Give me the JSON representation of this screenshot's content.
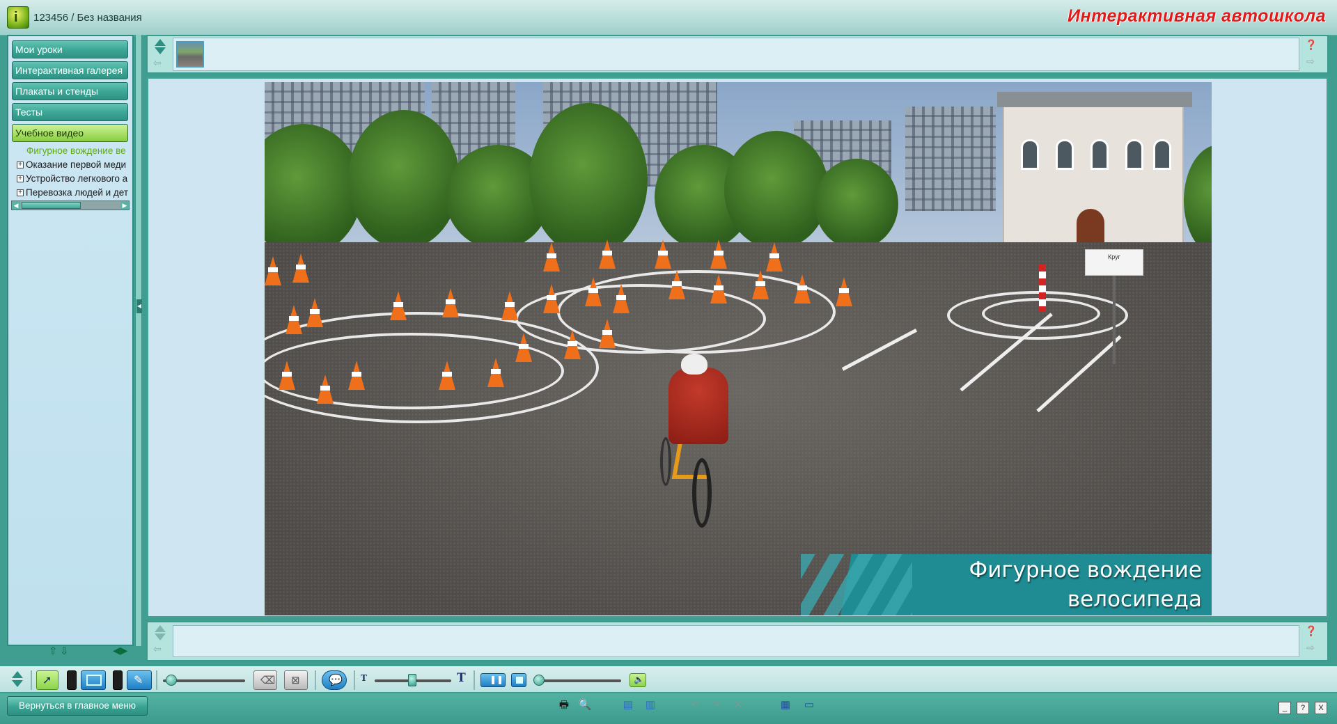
{
  "window": {
    "title": "123456 / Без названия",
    "brand": "Интерактивная автошкола",
    "logo_letter": "i"
  },
  "sidebar": {
    "buttons": [
      {
        "label": "Мои уроки"
      },
      {
        "label": "Интерактивная галерея"
      },
      {
        "label": "Плакаты и стенды"
      },
      {
        "label": "Тесты"
      },
      {
        "label": "Учебное видео"
      }
    ],
    "tree": [
      {
        "label": "Фигурное вождение ве",
        "selected": true
      },
      {
        "label": "Оказание первой меди",
        "expander": "⊞"
      },
      {
        "label": "Устройство легкового а",
        "expander": "⊞"
      },
      {
        "label": "Перевозка людей и дет",
        "expander": "⊞"
      }
    ]
  },
  "video": {
    "caption_line1": "Фигурное вождение",
    "caption_line2": "велосипеда",
    "sign_text": "Круг"
  },
  "bottom": {
    "main_menu": "Вернуться в главное меню",
    "window_min": "_",
    "window_help": "?",
    "window_close": "X"
  },
  "toolbar": {
    "font_small": "T",
    "font_large": "T"
  },
  "colors": {
    "accent": "#3f9e90",
    "brand": "#e31a1a",
    "active_nav": "#a8df66"
  }
}
